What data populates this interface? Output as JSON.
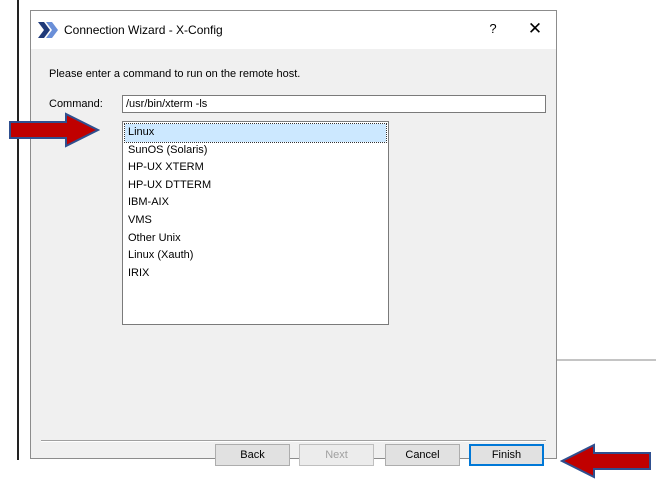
{
  "window": {
    "title": "Connection Wizard - X-Config",
    "help_glyph": "?",
    "close_glyph": "✕"
  },
  "main": {
    "prompt": "Please enter a command to run on the remote host.",
    "command_label": "Command:",
    "command_value": "/usr/bin/xterm -ls",
    "list_items": [
      {
        "label": "Linux",
        "selected": true
      },
      {
        "label": "SunOS (Solaris)",
        "selected": false
      },
      {
        "label": "HP-UX XTERM",
        "selected": false
      },
      {
        "label": "HP-UX DTTERM",
        "selected": false
      },
      {
        "label": "IBM-AIX",
        "selected": false
      },
      {
        "label": "VMS",
        "selected": false
      },
      {
        "label": "Other Unix",
        "selected": false
      },
      {
        "label": "Linux (Xauth)",
        "selected": false
      },
      {
        "label": "IRIX",
        "selected": false
      }
    ]
  },
  "footer": {
    "back_label": "Back",
    "next_label": "Next",
    "cancel_label": "Cancel",
    "finish_label": "Finish"
  },
  "colors": {
    "arrow_fill": "#c00000",
    "arrow_stroke": "#2f4f8f",
    "selection": "#cce8ff",
    "default_button_border": "#0078d7"
  }
}
